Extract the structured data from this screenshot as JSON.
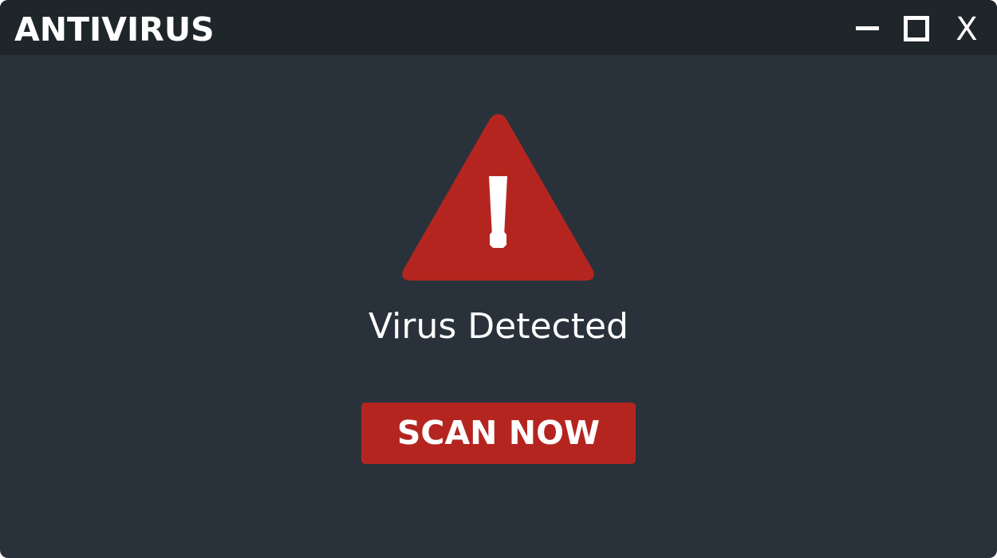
{
  "window": {
    "title": "ANTIVIRUS",
    "controls": {
      "minimize_icon": "minimize-icon",
      "maximize_icon": "maximize-icon",
      "close_label": "X"
    }
  },
  "alert": {
    "icon": "warning-triangle-icon",
    "message": "Virus Detected",
    "action_label": "SCAN NOW"
  },
  "colors": {
    "window_background": "#29323a",
    "titlebar_background": "#1f2629",
    "alert_red": "#b52520",
    "text": "#ffffff"
  }
}
